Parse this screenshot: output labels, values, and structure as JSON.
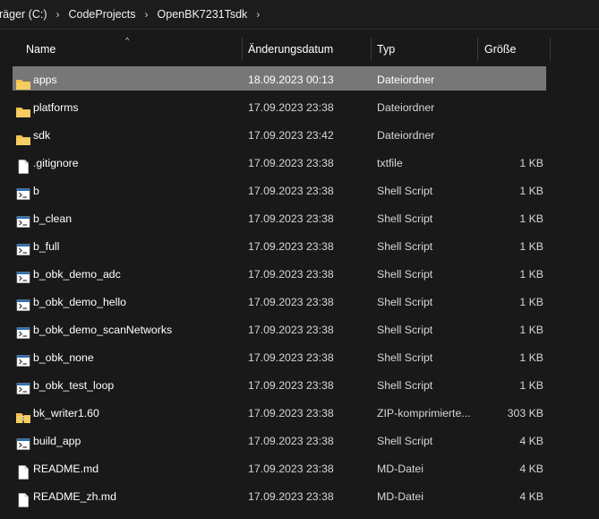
{
  "breadcrumb": {
    "items": [
      "räger (C:)",
      "CodeProjects",
      "OpenBK7231Tsdk"
    ],
    "separator": "›"
  },
  "columns": {
    "name": "Name",
    "date": "Änderungsdatum",
    "type": "Typ",
    "size": "Größe",
    "sort_indicator": "^"
  },
  "colors": {
    "background": "#191919",
    "selected_row": "#777777",
    "folder": "#f2c14e"
  },
  "files": [
    {
      "name": "apps",
      "date": "18.09.2023 00:13",
      "type": "Dateiordner",
      "size": "",
      "icon": "folder-icon",
      "selected": true
    },
    {
      "name": "platforms",
      "date": "17.09.2023 23:38",
      "type": "Dateiordner",
      "size": "",
      "icon": "folder-icon",
      "selected": false
    },
    {
      "name": "sdk",
      "date": "17.09.2023 23:42",
      "type": "Dateiordner",
      "size": "",
      "icon": "folder-icon",
      "selected": false
    },
    {
      "name": ".gitignore",
      "date": "17.09.2023 23:38",
      "type": "txtfile",
      "size": "1 KB",
      "icon": "file-icon",
      "selected": false
    },
    {
      "name": "b",
      "date": "17.09.2023 23:38",
      "type": "Shell Script",
      "size": "1 KB",
      "icon": "shell-script-icon",
      "selected": false
    },
    {
      "name": "b_clean",
      "date": "17.09.2023 23:38",
      "type": "Shell Script",
      "size": "1 KB",
      "icon": "shell-script-icon",
      "selected": false
    },
    {
      "name": "b_full",
      "date": "17.09.2023 23:38",
      "type": "Shell Script",
      "size": "1 KB",
      "icon": "shell-script-icon",
      "selected": false
    },
    {
      "name": "b_obk_demo_adc",
      "date": "17.09.2023 23:38",
      "type": "Shell Script",
      "size": "1 KB",
      "icon": "shell-script-icon",
      "selected": false
    },
    {
      "name": "b_obk_demo_hello",
      "date": "17.09.2023 23:38",
      "type": "Shell Script",
      "size": "1 KB",
      "icon": "shell-script-icon",
      "selected": false
    },
    {
      "name": "b_obk_demo_scanNetworks",
      "date": "17.09.2023 23:38",
      "type": "Shell Script",
      "size": "1 KB",
      "icon": "shell-script-icon",
      "selected": false
    },
    {
      "name": "b_obk_none",
      "date": "17.09.2023 23:38",
      "type": "Shell Script",
      "size": "1 KB",
      "icon": "shell-script-icon",
      "selected": false
    },
    {
      "name": "b_obk_test_loop",
      "date": "17.09.2023 23:38",
      "type": "Shell Script",
      "size": "1 KB",
      "icon": "shell-script-icon",
      "selected": false
    },
    {
      "name": "bk_writer1.60",
      "date": "17.09.2023 23:38",
      "type": "ZIP-komprimierte...",
      "size": "303 KB",
      "icon": "zip-folder-icon",
      "selected": false
    },
    {
      "name": "build_app",
      "date": "17.09.2023 23:38",
      "type": "Shell Script",
      "size": "4 KB",
      "icon": "shell-script-icon",
      "selected": false
    },
    {
      "name": "README.md",
      "date": "17.09.2023 23:38",
      "type": "MD-Datei",
      "size": "4 KB",
      "icon": "file-icon",
      "selected": false
    },
    {
      "name": "README_zh.md",
      "date": "17.09.2023 23:38",
      "type": "MD-Datei",
      "size": "4 KB",
      "icon": "file-icon",
      "selected": false
    }
  ]
}
